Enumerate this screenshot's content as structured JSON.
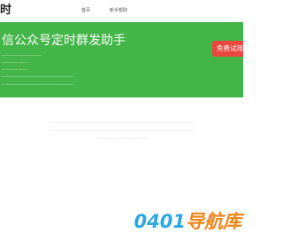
{
  "header": {
    "logo_text": "时",
    "nav": [
      {
        "label": "首页"
      },
      {
        "label": "新手帮助"
      }
    ]
  },
  "banner": {
    "headline": "信公众号定时群发助手",
    "info": [
      "——————————",
      "————  ——",
      "————  ——",
      "——————————————————",
      "——————————————————"
    ],
    "trial_button": "免费试用",
    "colors": {
      "background": "#44b549",
      "button": "#e9473f"
    }
  },
  "footer": {
    "lines": [
      "———————————————————————————————————————————————",
      "———————————————————————————————————————————————",
      "—————————————————"
    ]
  },
  "watermark": {
    "number": "0401",
    "text": "导航库"
  }
}
